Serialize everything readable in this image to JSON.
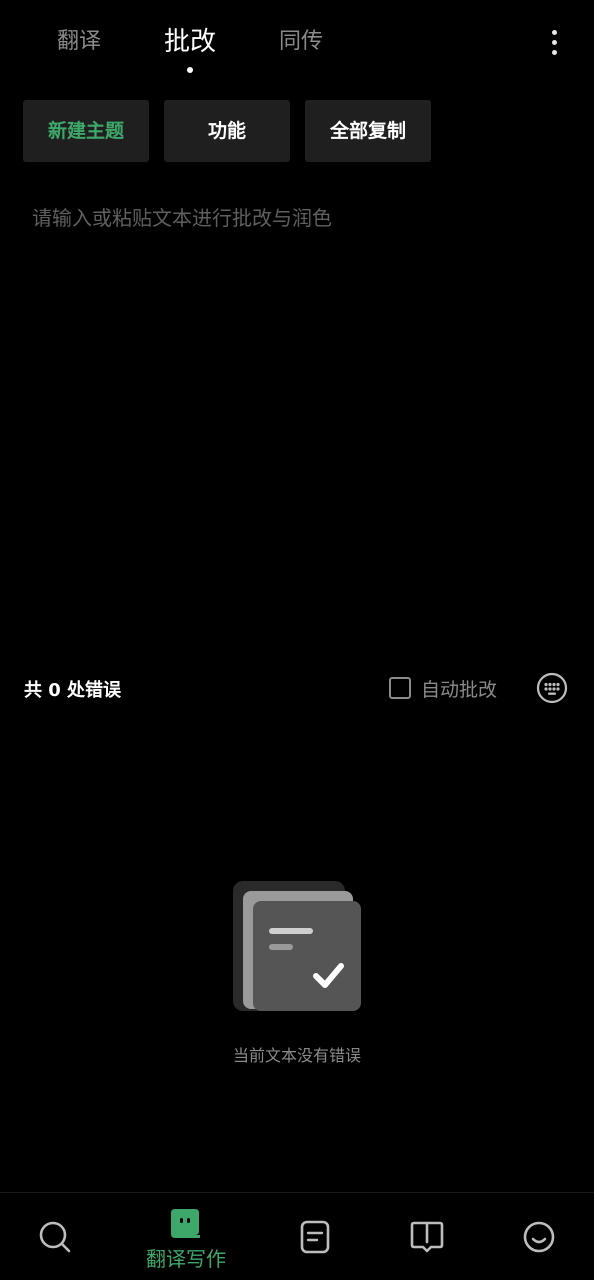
{
  "colors": {
    "accent": "#3ea86a",
    "background": "#000000",
    "button_bg": "#1f1f1f",
    "muted_text": "#8a8a8a"
  },
  "top_tabs": [
    {
      "label": "翻译",
      "active": false
    },
    {
      "label": "批改",
      "active": true
    },
    {
      "label": "同传",
      "active": false
    }
  ],
  "menu": {
    "icon": "more-vertical-icon"
  },
  "actions": {
    "new_topic": "新建主题",
    "functions": "功能",
    "copy_all": "全部复制"
  },
  "editor": {
    "placeholder": "请输入或粘贴文本进行批改与润色",
    "value": ""
  },
  "errors": {
    "summary": "共 0 处错误",
    "auto_check_label": "自动批改",
    "auto_check_checked": false,
    "keyboard_icon": "keyboard-icon"
  },
  "empty_state": {
    "icon": "no-errors-document-check-icon",
    "message": "当前文本没有错误"
  },
  "bottom_nav": [
    {
      "icon": "search-icon",
      "label": "",
      "active": false
    },
    {
      "icon": "assistant-chat-icon",
      "label": "翻译写作",
      "active": true
    },
    {
      "icon": "notes-icon",
      "label": "",
      "active": false
    },
    {
      "icon": "book-icon",
      "label": "",
      "active": false
    },
    {
      "icon": "smiley-profile-icon",
      "label": "",
      "active": false
    }
  ]
}
